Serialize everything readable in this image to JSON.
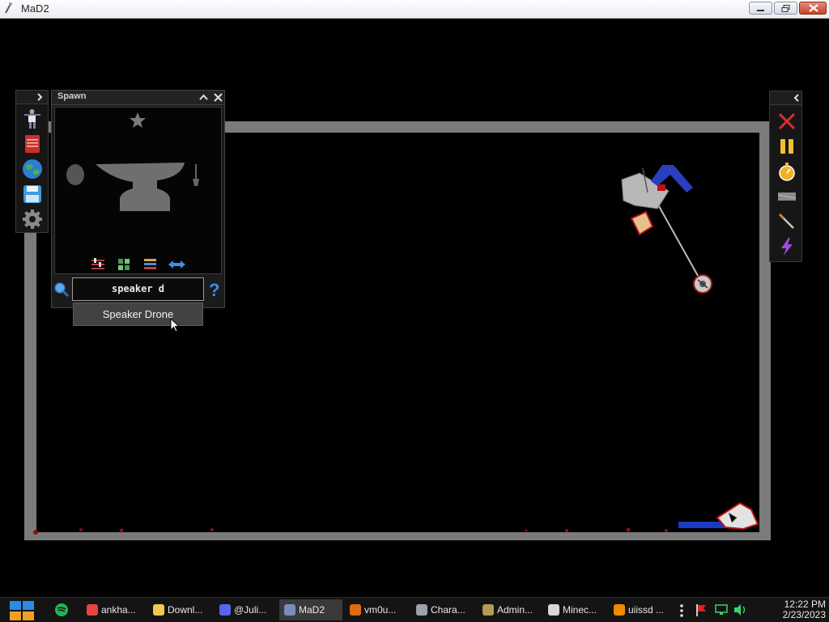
{
  "window": {
    "title": "MaD2"
  },
  "left_toolbar": {
    "tools": [
      {
        "name": "pose-figure-icon"
      },
      {
        "name": "notebook-icon"
      },
      {
        "name": "globe-icon"
      },
      {
        "name": "save-icon"
      },
      {
        "name": "gear-icon"
      }
    ]
  },
  "spawn_panel": {
    "title": "Spawn",
    "preview_items": [
      "star-icon",
      "egg-icon",
      "anvil-icon",
      "shovel-icon"
    ],
    "controls": [
      "sliders-icon",
      "grid-icon",
      "list-icon",
      "swap-arrows-icon"
    ],
    "search": {
      "value": "speaker d"
    },
    "suggestion": "Speaker Drone"
  },
  "right_toolbar": {
    "tools": [
      {
        "name": "close-x-icon"
      },
      {
        "name": "pause-icon"
      },
      {
        "name": "stopwatch-icon"
      },
      {
        "name": "slab-icon"
      },
      {
        "name": "knife-icon"
      },
      {
        "name": "lightning-icon"
      }
    ]
  },
  "taskbar": {
    "items": [
      {
        "label": "ankha...",
        "icon": "chrome-icon",
        "color": "#e8453c"
      },
      {
        "label": "Downl...",
        "icon": "folder-icon",
        "color": "#f2c94c"
      },
      {
        "label": "@Juli...",
        "icon": "discord-icon",
        "color": "#5865f2"
      },
      {
        "label": "MaD2",
        "icon": "mad2-icon",
        "color": "#7a8bbd",
        "active": true
      },
      {
        "label": "vm0u...",
        "icon": "vm-icon",
        "color": "#e06a14"
      },
      {
        "label": "Chara...",
        "icon": "character-icon",
        "color": "#9aa3ad"
      },
      {
        "label": "Admin...",
        "icon": "admin-icon",
        "color": "#b39b54"
      },
      {
        "label": "Minec...",
        "icon": "minecraft-icon",
        "color": "#d8d8d8"
      },
      {
        "label": "uiissd ...",
        "icon": "vlc-icon",
        "color": "#f08a00"
      }
    ],
    "clock": {
      "time": "12:22 PM",
      "date": "2/23/2023"
    }
  }
}
